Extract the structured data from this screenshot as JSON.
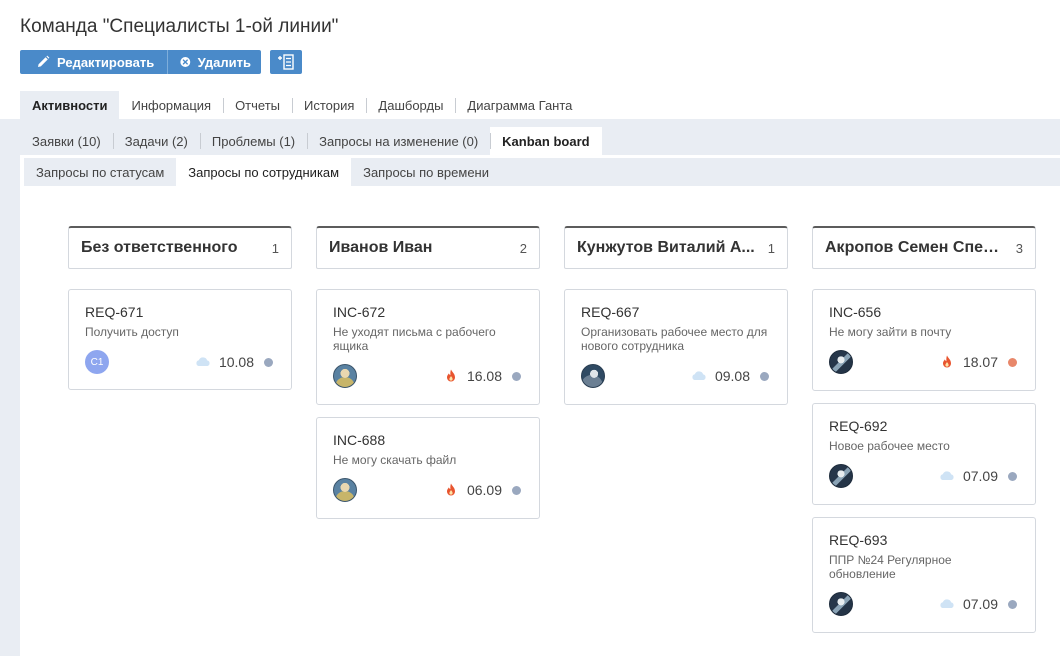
{
  "page": {
    "title": "Команда \"Специалисты 1-ой линии\""
  },
  "toolbar": {
    "edit_label": "Редактировать",
    "delete_label": "Удалить",
    "accent": "#4a8ac9"
  },
  "tabs_main": [
    {
      "label": "Активности",
      "active": true
    },
    {
      "label": "Информация"
    },
    {
      "label": "Отчеты"
    },
    {
      "label": "История"
    },
    {
      "label": "Дашборды"
    },
    {
      "label": "Диаграмма Ганта"
    }
  ],
  "tabs_sub": [
    {
      "label": "Заявки (10)"
    },
    {
      "label": "Задачи (2)"
    },
    {
      "label": "Проблемы (1)"
    },
    {
      "label": "Запросы на изменение (0)"
    },
    {
      "label": "Kanban board",
      "active": true
    }
  ],
  "tabs_view": [
    {
      "label": "Запросы по статусам"
    },
    {
      "label": "Запросы по сотрудникам",
      "active": true
    },
    {
      "label": "Запросы по времени"
    }
  ],
  "colors": {
    "dot_normal": "#9aa8bf",
    "dot_urgent": "#e8876a",
    "cloud": "#cfe3f5",
    "fire": "#e8542e"
  },
  "columns": [
    {
      "title": "Без ответственного",
      "count": "1",
      "cards": [
        {
          "id": "REQ-671",
          "desc": "Получить доступ",
          "avatar": "initials",
          "initials": "С1",
          "priority": "cloud-icon",
          "date": "10.08",
          "status": "normal"
        }
      ]
    },
    {
      "title": "Иванов Иван",
      "count": "2",
      "cards": [
        {
          "id": "INC-672",
          "desc": "Не уходят письма с рабочего ящика",
          "avatar": "photo1",
          "priority": "fire-icon",
          "date": "16.08",
          "status": "normal"
        },
        {
          "id": "INC-688",
          "desc": "Не могу скачать файл",
          "avatar": "photo1",
          "priority": "fire-icon",
          "date": "06.09",
          "status": "normal"
        }
      ]
    },
    {
      "title": "Кунжутов Виталий А...",
      "count": "1",
      "cards": [
        {
          "id": "REQ-667",
          "desc": "Организовать рабочее место для нового сотрудника",
          "avatar": "photo2",
          "priority": "cloud-icon",
          "date": "09.08",
          "status": "normal"
        }
      ]
    },
    {
      "title": "Акропов Семен Спец...",
      "count": "3",
      "cards": [
        {
          "id": "INC-656",
          "desc": "Не могу зайти в почту",
          "avatar": "photo3",
          "priority": "fire-icon",
          "date": "18.07",
          "status": "urgent"
        },
        {
          "id": "REQ-692",
          "desc": "Новое рабочее место",
          "avatar": "photo3",
          "priority": "cloud-icon",
          "date": "07.09",
          "status": "normal"
        },
        {
          "id": "REQ-693",
          "desc": "ППР №24 Регулярное обновление",
          "avatar": "photo3",
          "priority": "cloud-icon",
          "date": "07.09",
          "status": "normal"
        }
      ]
    }
  ]
}
